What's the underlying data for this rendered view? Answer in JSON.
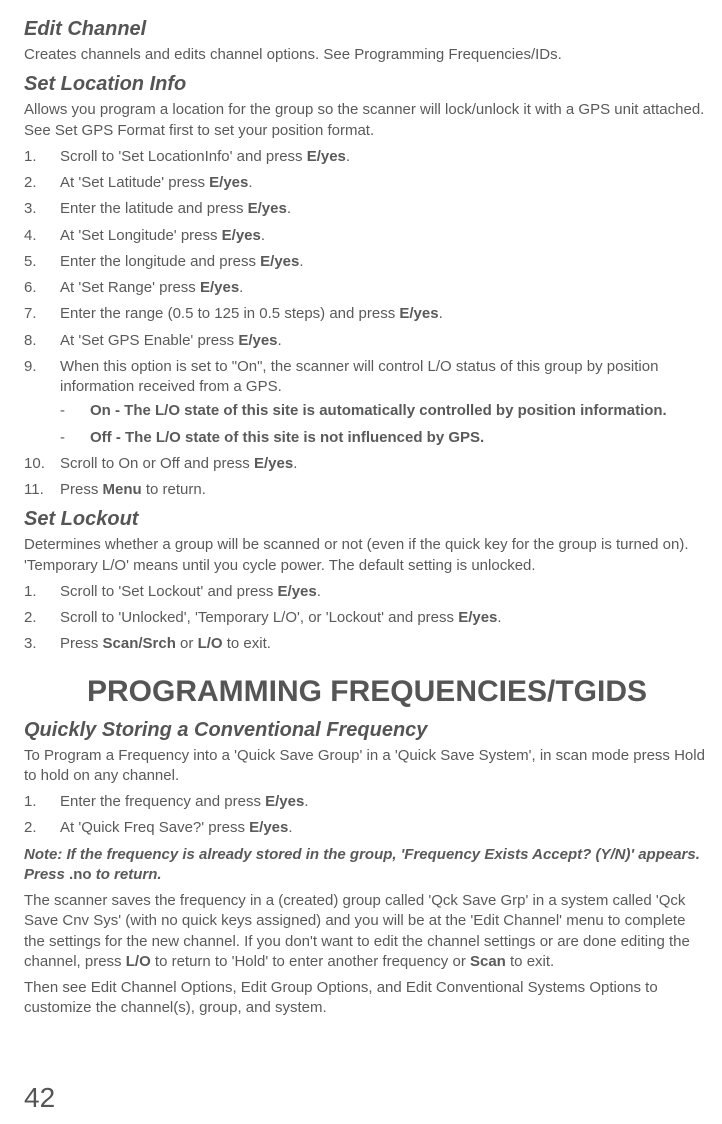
{
  "editChannel": {
    "heading": "Edit Channel",
    "desc": "Creates channels and edits channel options. See Programming Frequencies/IDs."
  },
  "setLocationInfo": {
    "heading": "Set Location Info",
    "desc": "Allows you program a location for the group so the scanner will lock/unlock it with a GPS unit attached. See Set GPS Format first to set your position format.",
    "steps": [
      {
        "pre": "Scroll to 'Set LocationInfo' and press ",
        "bold": "E/yes",
        "post": "."
      },
      {
        "pre": "At 'Set Latitude' press ",
        "bold": "E/yes",
        "post": "."
      },
      {
        "pre": "Enter the latitude and press ",
        "bold": "E/yes",
        "post": "."
      },
      {
        "pre": "At 'Set Longitude' press ",
        "bold": "E/yes",
        "post": "."
      },
      {
        "pre": "Enter the longitude and press ",
        "bold": "E/yes",
        "post": "."
      },
      {
        "pre": "At 'Set Range' press ",
        "bold": "E/yes",
        "post": "."
      },
      {
        "pre": "Enter the range (0.5 to 125 in 0.5 steps) and press ",
        "bold": "E/yes",
        "post": "."
      },
      {
        "pre": "At 'Set GPS Enable' press ",
        "bold": "E/yes",
        "post": "."
      },
      {
        "pre": "When this option is set to \"On\", the scanner will control L/O status of this group by position information received from a GPS.",
        "bold": "",
        "post": ""
      }
    ],
    "subBullets": [
      "On - The L/O state of this site is automatically controlled by position information.",
      "Off - The L/O state of this site is not influenced by GPS."
    ],
    "steps2": [
      {
        "num": "10.",
        "pre": "Scroll to On or Off and press ",
        "bold": "E/yes",
        "post": "."
      },
      {
        "num": "11.",
        "pre": "Press ",
        "bold": "Menu",
        "post": " to return."
      }
    ]
  },
  "setLockout": {
    "heading": "Set Lockout",
    "desc": "Determines whether a group will be scanned or not (even if the quick key for the group is turned on). 'Temporary L/O' means until you cycle power. The default setting is unlocked.",
    "steps": [
      {
        "pre": "Scroll to 'Set Lockout' and press ",
        "bold": "E/yes",
        "post": "."
      },
      {
        "pre": "Scroll to 'Unlocked', 'Temporary L/O', or 'Lockout' and press ",
        "bold": "E/yes",
        "post": "."
      },
      {
        "pre": "Press ",
        "bold": "Scan/Srch",
        "mid": " or ",
        "bold2": "L/O",
        "post": " to exit."
      }
    ]
  },
  "mainHeading": "PROGRAMMING FREQUENCIES/TGIDS",
  "quickStore": {
    "heading": "Quickly Storing a Conventional Frequency",
    "desc": "To Program a Frequency into a 'Quick Save Group' in a 'Quick Save System', in scan mode press Hold to hold on any channel.",
    "steps": [
      {
        "pre": "Enter the frequency and press ",
        "bold": "E/yes",
        "post": "."
      },
      {
        "pre": "At 'Quick Freq Save?' press ",
        "bold": "E/yes",
        "post": "."
      }
    ],
    "note": {
      "part1": "Note: If the frequency is already stored in the group, 'Frequency Exists Accept? (Y/N)' appears. Press ",
      "boldPart": ".no",
      "part2": " to return."
    },
    "para1": {
      "t1": "The scanner saves the frequency in a (created) group called 'Qck Save Grp' in a system called 'Qck Save Cnv Sys' (with no quick keys assigned) and you will be at the 'Edit Channel' menu to complete the settings for the new channel. If you don't want to edit the channel settings or are done editing the channel, press ",
      "b1": "L/O",
      "t2": " to return to 'Hold' to enter another frequency or ",
      "b2": "Scan",
      "t3": " to exit."
    },
    "para2": "Then see Edit Channel Options, Edit Group Options, and Edit Conventional Systems Options to customize the channel(s), group, and system."
  },
  "pageNum": "42"
}
